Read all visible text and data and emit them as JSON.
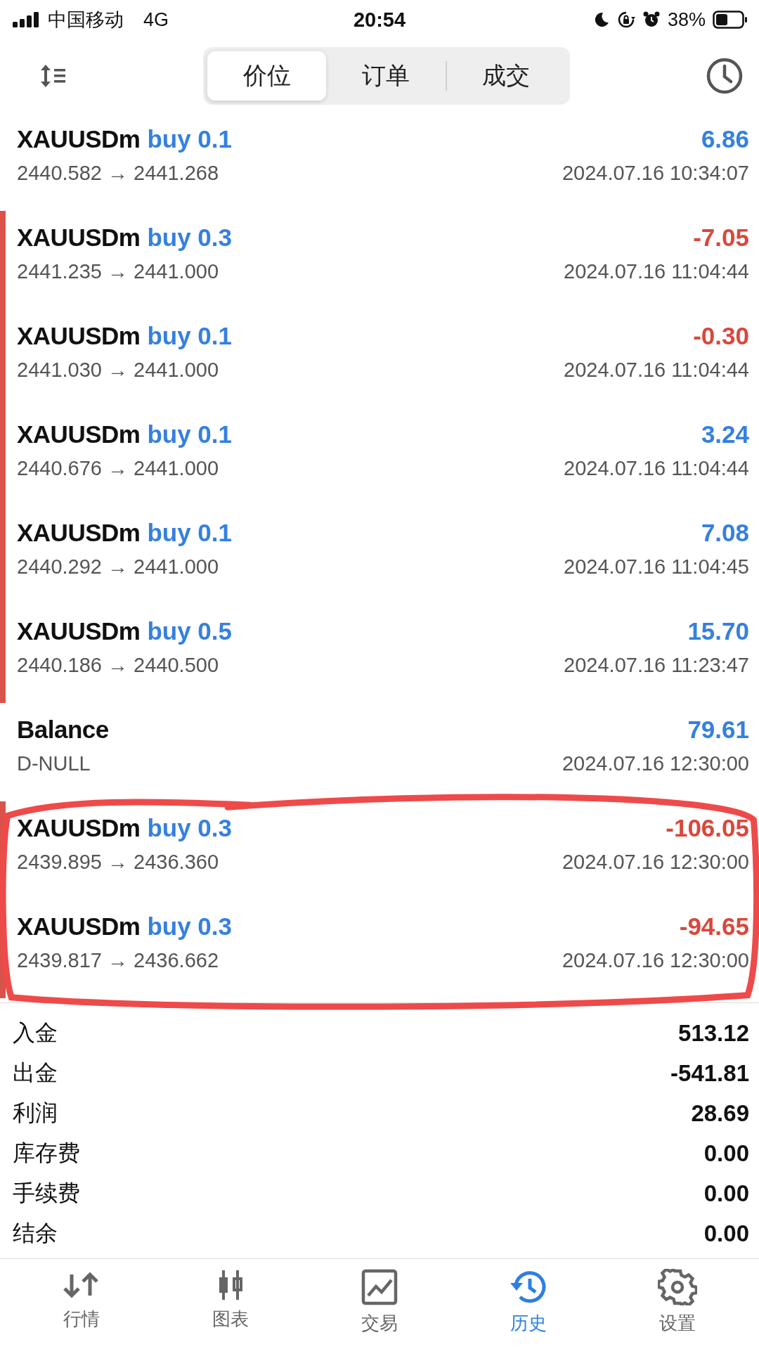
{
  "status_bar": {
    "carrier": "中国移动",
    "network": "4G",
    "time": "20:54",
    "battery": "38%"
  },
  "tabs": [
    {
      "label": "价位",
      "selected": true
    },
    {
      "label": "订单",
      "selected": false
    },
    {
      "label": "成交",
      "selected": false
    }
  ],
  "rows": [
    {
      "kind": "trade",
      "symbol": "XAUUSDm",
      "side": "buy 0.1",
      "amount": "6.86",
      "color": "#3580e0",
      "prices": "2440.582 → 2441.268",
      "time": "2024.07.16 10:34:07",
      "marked": false,
      "circled": false
    },
    {
      "kind": "trade",
      "symbol": "XAUUSDm",
      "side": "buy 0.3",
      "amount": "-7.05",
      "color": "#d9483b",
      "prices": "2441.235 → 2441.000",
      "time": "2024.07.16 11:04:44",
      "marked": true,
      "circled": false
    },
    {
      "kind": "trade",
      "symbol": "XAUUSDm",
      "side": "buy 0.1",
      "amount": "-0.30",
      "color": "#d9483b",
      "prices": "2441.030 → 2441.000",
      "time": "2024.07.16 11:04:44",
      "marked": true,
      "circled": false
    },
    {
      "kind": "trade",
      "symbol": "XAUUSDm",
      "side": "buy 0.1",
      "amount": "3.24",
      "color": "#3580e0",
      "prices": "2440.676 → 2441.000",
      "time": "2024.07.16 11:04:44",
      "marked": true,
      "circled": false
    },
    {
      "kind": "trade",
      "symbol": "XAUUSDm",
      "side": "buy 0.1",
      "amount": "7.08",
      "color": "#3580e0",
      "prices": "2440.292 → 2441.000",
      "time": "2024.07.16 11:04:45",
      "marked": true,
      "circled": false
    },
    {
      "kind": "trade",
      "symbol": "XAUUSDm",
      "side": "buy 0.5",
      "amount": "15.70",
      "color": "#3580e0",
      "prices": "2440.186 → 2440.500",
      "time": "2024.07.16 11:23:47",
      "marked": true,
      "circled": false
    },
    {
      "kind": "balance",
      "symbol": "Balance",
      "amount": "79.61",
      "color": "#3580e0",
      "prices": "D-NULL",
      "time": "2024.07.16 12:30:00",
      "marked": false,
      "circled": false
    },
    {
      "kind": "trade",
      "symbol": "XAUUSDm",
      "side": "buy 0.3",
      "amount": "-106.05",
      "color": "#d9483b",
      "prices": "2439.895 → 2436.360",
      "time": "2024.07.16 12:30:00",
      "marked": true,
      "circled": true
    },
    {
      "kind": "trade",
      "symbol": "XAUUSDm",
      "side": "buy 0.3",
      "amount": "-94.65",
      "color": "#d9483b",
      "prices": "2439.817 → 2436.662",
      "time": "2024.07.16 12:30:00",
      "marked": true,
      "circled": true
    }
  ],
  "summary": [
    {
      "label": "入金",
      "value": "513.12"
    },
    {
      "label": "出金",
      "value": "-541.81"
    },
    {
      "label": "利润",
      "value": "28.69"
    },
    {
      "label": "库存费",
      "value": "0.00"
    },
    {
      "label": "手续费",
      "value": "0.00"
    },
    {
      "label": "结余",
      "value": "0.00"
    }
  ],
  "nav": [
    {
      "kind": "quotes",
      "label": "行情",
      "selected": false
    },
    {
      "kind": "chart",
      "label": "图表",
      "selected": false
    },
    {
      "kind": "trade",
      "label": "交易",
      "selected": false
    },
    {
      "kind": "history",
      "label": "历史",
      "selected": true
    },
    {
      "kind": "settings",
      "label": "设置",
      "selected": false
    }
  ]
}
